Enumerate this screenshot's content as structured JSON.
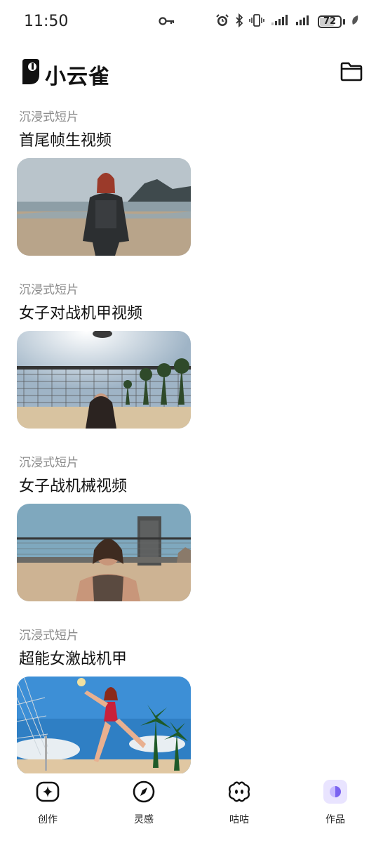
{
  "status_bar": {
    "time": "11:50",
    "battery_level": "72",
    "battery_percent": 72
  },
  "header": {
    "app_name": "小云雀"
  },
  "feed": [
    {
      "category": "沉浸式短片",
      "title": "首尾帧生视频"
    },
    {
      "category": "沉浸式短片",
      "title": "女子对战机甲视频"
    },
    {
      "category": "沉浸式短片",
      "title": "女子战机械视频"
    },
    {
      "category": "沉浸式短片",
      "title": "超能女激战机甲"
    }
  ],
  "bottom_nav": [
    {
      "label": "创作",
      "icon": "sparkle-icon"
    },
    {
      "label": "灵感",
      "icon": "compass-icon"
    },
    {
      "label": "咕咕",
      "icon": "cloud-face-icon"
    },
    {
      "label": "作品",
      "icon": "works-icon",
      "active": true
    }
  ],
  "colors": {
    "accent": "#7a63f0",
    "accent_bg": "#e9e4ff",
    "text_primary": "#111111",
    "text_secondary": "#8a8a8a"
  }
}
